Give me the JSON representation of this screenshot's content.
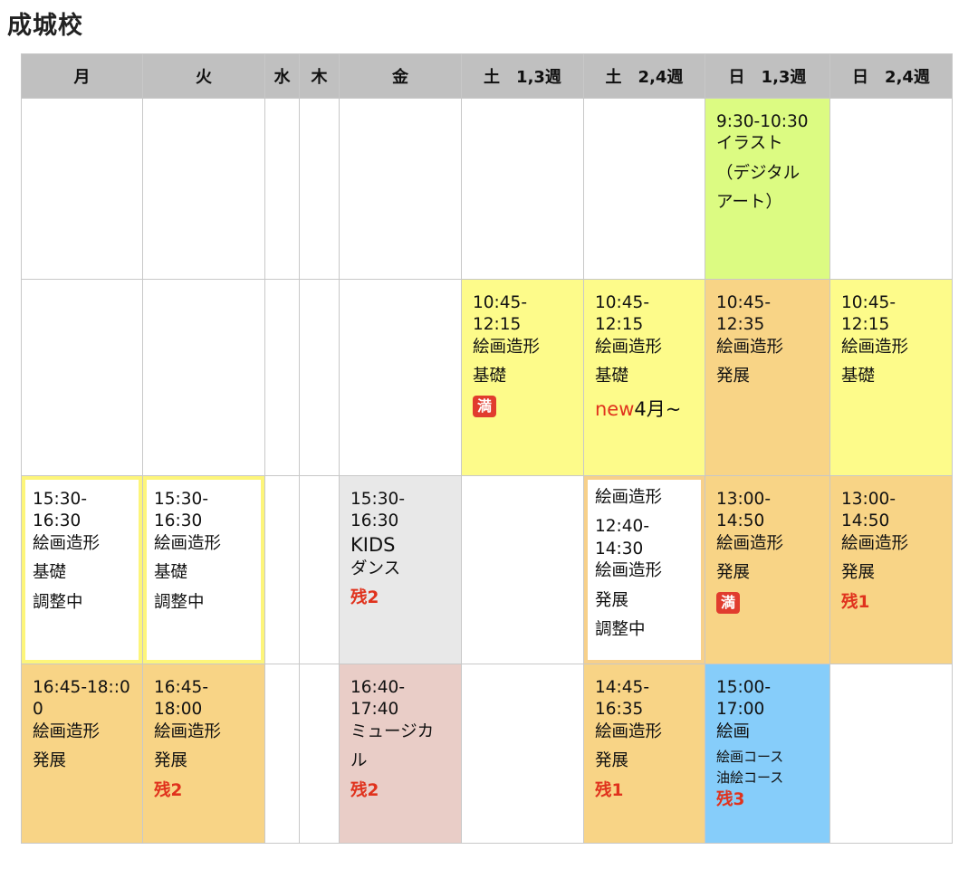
{
  "page": {
    "title": "成城校"
  },
  "headers": [
    "月",
    "火",
    "水",
    "木",
    "金",
    "土　1,3週",
    "土　2,4週",
    "日　1,3週",
    "日　2,4週"
  ],
  "rows": {
    "r1": {
      "sun13": [
        "9:30-10:30",
        "イラスト",
        "（デジタル",
        "アート）"
      ]
    },
    "r2": {
      "sat13": [
        "10:45-",
        "12:15",
        "絵画造形",
        "基礎"
      ],
      "sat13_badge": "満",
      "sat24": [
        "10:45-",
        "12:15",
        "絵画造形",
        "基礎"
      ],
      "sat24_new": "new",
      "sat24_new_suffix": "4月~",
      "sun13": [
        "10:45-",
        "12:35",
        "絵画造形",
        "発展"
      ],
      "sun24": [
        "10:45-",
        "12:15",
        "絵画造形",
        "基礎"
      ]
    },
    "r3": {
      "mon": [
        "15:30-",
        "16:30",
        "絵画造形",
        "基礎",
        "調整中"
      ],
      "tue": [
        "15:30-",
        "16:30",
        "絵画造形",
        "基礎",
        "調整中"
      ],
      "fri": [
        "15:30-",
        "16:30",
        "KIDS",
        "ダンス"
      ],
      "fri_remaining": "残2",
      "sat24": [
        "絵画造形",
        "12:40-",
        "14:30",
        "絵画造形",
        "発展",
        "調整中"
      ],
      "sun13": [
        "13:00-14:50",
        "絵画造形",
        "発展"
      ],
      "sun13_badge": "満",
      "sun24": [
        "13:00-14:50",
        "絵画造形",
        "発展"
      ],
      "sun24_remaining": "残1"
    },
    "r4": {
      "mon": [
        "16:45-18::0",
        "0",
        "絵画造形",
        "発展"
      ],
      "tue": [
        "16:45-18:00",
        "絵画造形",
        "発展"
      ],
      "tue_remaining": "残2",
      "fri": [
        "16:40-",
        "17:40",
        "ミュージカ",
        "ル"
      ],
      "fri_remaining": "残2",
      "sat24": [
        "14:45-",
        "16:35",
        "絵画造形",
        "発展"
      ],
      "sat24_remaining": "残1",
      "sun13": [
        "15:00-",
        "17:00",
        "絵画"
      ],
      "sun13_small": [
        "絵画コース",
        "油絵コース"
      ],
      "sun13_remaining": "残3"
    }
  },
  "colors": {
    "header_bg": "#c0c0c0",
    "yellow": "#fdfb8a",
    "orange": "#f8d486",
    "green": "#dcfb82",
    "gray": "#e8e8e8",
    "pink": "#e9cdc7",
    "blue": "#86cdfa",
    "remaining_red": "#e0321d"
  }
}
